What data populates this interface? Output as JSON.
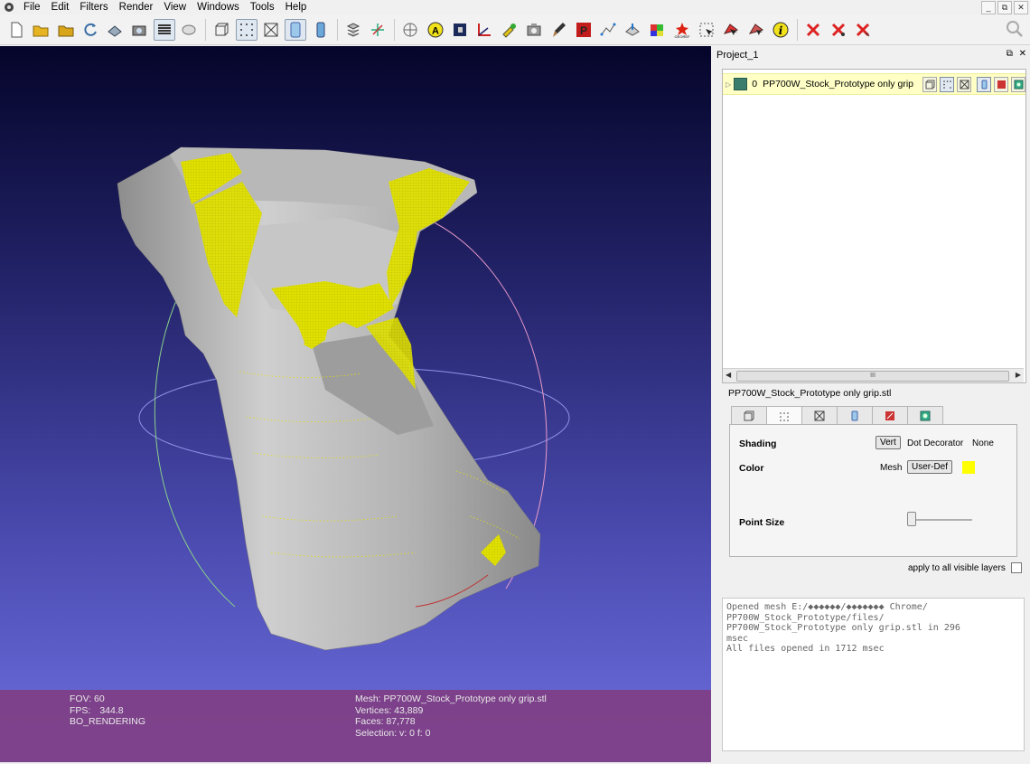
{
  "menubar": {
    "items": [
      "File",
      "Edit",
      "Filters",
      "Render",
      "View",
      "Windows",
      "Tools",
      "Help"
    ]
  },
  "window_controls": {
    "minimize": "_",
    "restore": "⧉",
    "close": "✕"
  },
  "toolbar": {
    "groups": [
      [
        "new-icon",
        "open-icon",
        "open-project-icon",
        "reload-icon",
        "import-icon",
        "snapshot-icon"
      ],
      [
        "layers-icon",
        "flat-icon"
      ],
      [
        "bbox-icon",
        "points-icon",
        "wire-icon",
        "smooth-icon",
        "texture-icon"
      ],
      [
        "mesh-layer-icon",
        "axis-icon"
      ],
      [
        "trackball-icon",
        "annotation-icon",
        "raster-icon",
        "measure-icon",
        "select-icon",
        "camera-icon",
        "paint-icon",
        "pickpoints-icon",
        "align-icon",
        "manipulator-icon",
        "color-icon",
        "georef-icon",
        "select-vertex-icon",
        "select-face-icon",
        "select-conn-icon",
        "info-icon"
      ],
      [
        "delete-faces-icon",
        "delete-vertices-icon",
        "delete-all-icon"
      ]
    ],
    "search_icon": "search-icon"
  },
  "viewport": {
    "fov_label": "FOV:",
    "fov_value": "60",
    "fps_label": "FPS:",
    "fps_value": "344.8",
    "render_mode": "BO_RENDERING",
    "mesh_line": "Mesh: PP700W_Stock_Prototype only grip.stl",
    "vertices_line": "Vertices: 43,889",
    "faces_line": "Faces: 87,778",
    "selection_line": "Selection: v: 0 f: 0",
    "colors": {
      "mesh": "#bdbdbd",
      "points": "#f6f600",
      "bg_top": "#05052a",
      "bg_bottom": "#6f6fe0",
      "info_bar": "#803c80"
    }
  },
  "project": {
    "title": "Project_1",
    "layer_index": "0",
    "layer_name": "PP700W_Stock_Prototype only grip",
    "scroll_thumb": "III"
  },
  "rendering": {
    "title": "PP700W_Stock_Prototype only grip.stl",
    "shading_label": "Shading",
    "shading_options": [
      "Vert",
      "Dot Decorator",
      "None"
    ],
    "color_label": "Color",
    "color_options": [
      "Mesh",
      "User-Def"
    ],
    "user_color": "#ffff00",
    "point_size_label": "Point Size",
    "point_size": 0.05,
    "apply_label": "apply to all visible layers"
  },
  "log": [
    "Opened mesh E:/◆◆◆◆◆◆/◆◆◆◆◆◆◆ Chrome/",
    "PP700W_Stock_Prototype/files/",
    "PP700W_Stock_Prototype only grip.stl in 296",
    "msec",
    "All files opened in 1712 msec"
  ]
}
